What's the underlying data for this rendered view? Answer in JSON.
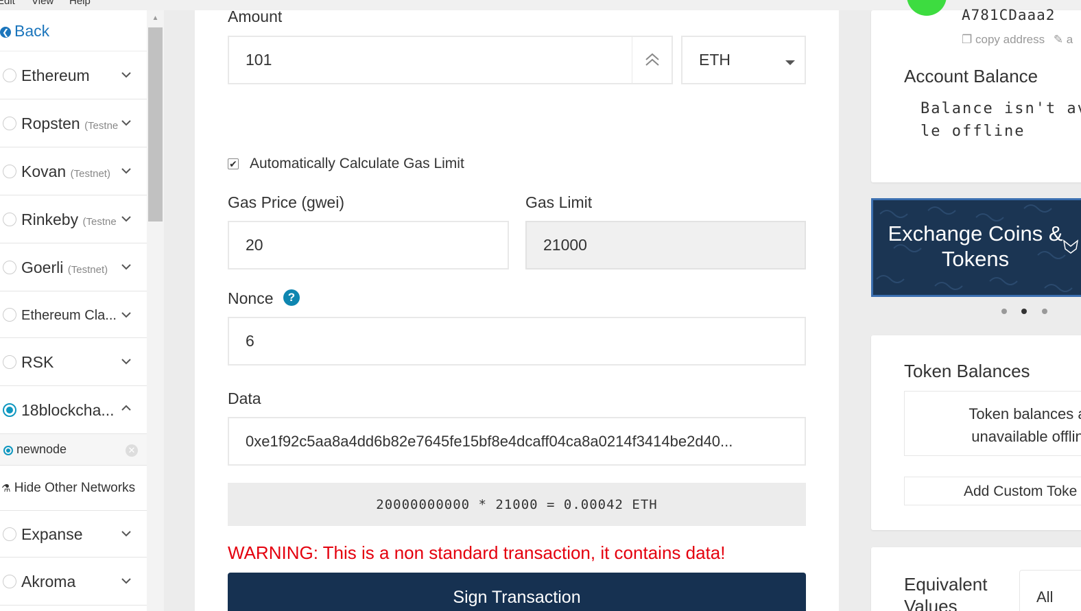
{
  "menubar": {
    "items": [
      "Edit",
      "View",
      "Help"
    ]
  },
  "sidebar": {
    "back_label": "Back",
    "networks": [
      {
        "name": "Ethereum",
        "sub": "",
        "selected": false,
        "expanded": false
      },
      {
        "name": "Ropsten",
        "sub": "(Testne",
        "selected": false,
        "expanded": false
      },
      {
        "name": "Kovan",
        "sub": "(Testnet)",
        "selected": false,
        "expanded": false
      },
      {
        "name": "Rinkeby",
        "sub": "(Testne",
        "selected": false,
        "expanded": false
      },
      {
        "name": "Goerli",
        "sub": "(Testnet)",
        "selected": false,
        "expanded": false
      },
      {
        "name": "Ethereum Cla...",
        "sub": "",
        "selected": false,
        "expanded": false
      },
      {
        "name": "RSK",
        "sub": "",
        "selected": false,
        "expanded": false
      },
      {
        "name": "18blockcha...",
        "sub": "",
        "selected": true,
        "expanded": true
      },
      {
        "name": "Expanse",
        "sub": "",
        "selected": false,
        "expanded": false
      },
      {
        "name": "Akroma",
        "sub": "",
        "selected": false,
        "expanded": false
      }
    ],
    "node": {
      "name": "newnode"
    },
    "hide_label": "Hide Other Networks"
  },
  "form": {
    "amount_label": "Amount",
    "amount_value": "101",
    "unit": "ETH",
    "auto_gas_label": "Automatically Calculate Gas Limit",
    "auto_gas_checked": true,
    "gas_price_label": "Gas Price (gwei)",
    "gas_price_value": "20",
    "gas_limit_label": "Gas Limit",
    "gas_limit_value": "21000",
    "nonce_label": "Nonce",
    "nonce_value": "6",
    "data_label": "Data",
    "data_value": "0xe1f92c5aa8a4dd6b82e7645fe15bf8e4dcaff04ca8a0214f3414be2d40...",
    "calculation": "20000000000 * 21000 = 0.00042 ETH",
    "warning": "WARNING: This is a non standard transaction, it contains data!",
    "sign_label": "Sign Transaction"
  },
  "account": {
    "address_fragment": "A781CDaaa2",
    "copy_label": "copy address",
    "balance_title": "Account Balance",
    "balance_text": "Balance isn't av\nle offline"
  },
  "promo": {
    "title": "Exchange Coins & Tokens",
    "dots": 3,
    "active_dot": 1
  },
  "tokens": {
    "title": "Token Balances",
    "message": "Token balances a\nunavailable offlin",
    "add_label": "Add Custom Toke"
  },
  "equivalent": {
    "title": "Equivalent Values",
    "select_value": "All"
  },
  "colors": {
    "accent": "#0e97c0",
    "link": "#1b75bc",
    "warning": "#e4000e",
    "button": "#163151"
  }
}
